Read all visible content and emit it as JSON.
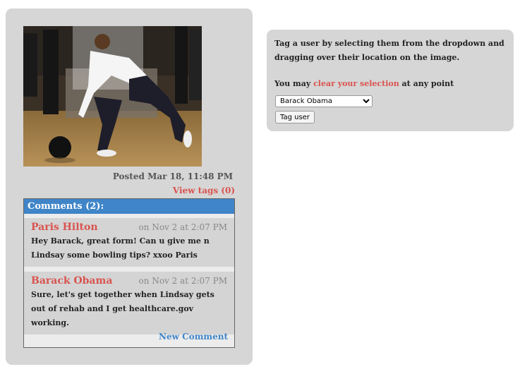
{
  "post": {
    "photo_alt": "Barack Obama bowling",
    "posted_label": "Posted",
    "posted_time": "Mar 18, 11:48 PM",
    "view_tags": "View tags (0)"
  },
  "comments": {
    "header": "Comments (2):",
    "items": [
      {
        "author": "Paris Hilton",
        "time": "on Nov 2 at 2:07 PM",
        "text": "Hey Barack, great form! Can u give me n Lindsay some bowling tips? xxoo Paris"
      },
      {
        "author": "Barack Obama",
        "time": "on Nov 2 at 2:07 PM",
        "text": "Sure, let's get together when Lindsay gets out of rehab and I get healthcare.gov working."
      }
    ],
    "new_comment": "New Comment"
  },
  "tag": {
    "instructions": "Tag a user by selecting them from the dropdown and dragging over their location on the image.",
    "you_may": "You may",
    "clear_link": "clear your selection",
    "at_any_point": "at any point",
    "selected_user": "Barack Obama",
    "button_label": "Tag user"
  }
}
